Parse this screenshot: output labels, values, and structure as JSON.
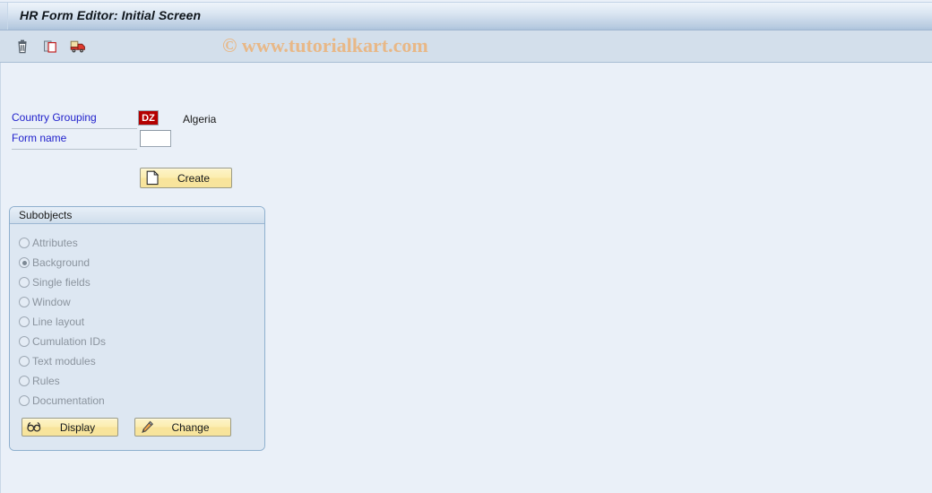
{
  "window": {
    "title": "HR Form Editor: Initial Screen"
  },
  "toolbar": {
    "icons": [
      {
        "name": "delete-icon",
        "glyph": "trash"
      },
      {
        "name": "copy-icon",
        "glyph": "copy"
      },
      {
        "name": "transport-icon",
        "glyph": "truck"
      }
    ],
    "watermark": "© www.tutorialkart.com"
  },
  "form": {
    "country_grouping": {
      "label": "Country Grouping",
      "value": "DZ",
      "placeholder": "",
      "description": "Algeria",
      "field_color": "#b40000"
    },
    "form_name": {
      "label": "Form name",
      "value": "",
      "placeholder": ""
    },
    "create_button": {
      "label": "Create",
      "icon": "new-document-icon"
    }
  },
  "subobjects": {
    "title": "Subobjects",
    "selected": "Background",
    "options": [
      {
        "label": "Attributes",
        "selected": false
      },
      {
        "label": "Background",
        "selected": true
      },
      {
        "label": "Single fields",
        "selected": false
      },
      {
        "label": "Window",
        "selected": false
      },
      {
        "label": "Line layout",
        "selected": false
      },
      {
        "label": "Cumulation IDs",
        "selected": false
      },
      {
        "label": "Text modules",
        "selected": false
      },
      {
        "label": "Rules",
        "selected": false
      },
      {
        "label": "Documentation",
        "selected": false
      }
    ],
    "actions": [
      {
        "label": "Display",
        "icon": "glasses-icon"
      },
      {
        "label": "Change",
        "icon": "pencil-icon"
      }
    ]
  }
}
